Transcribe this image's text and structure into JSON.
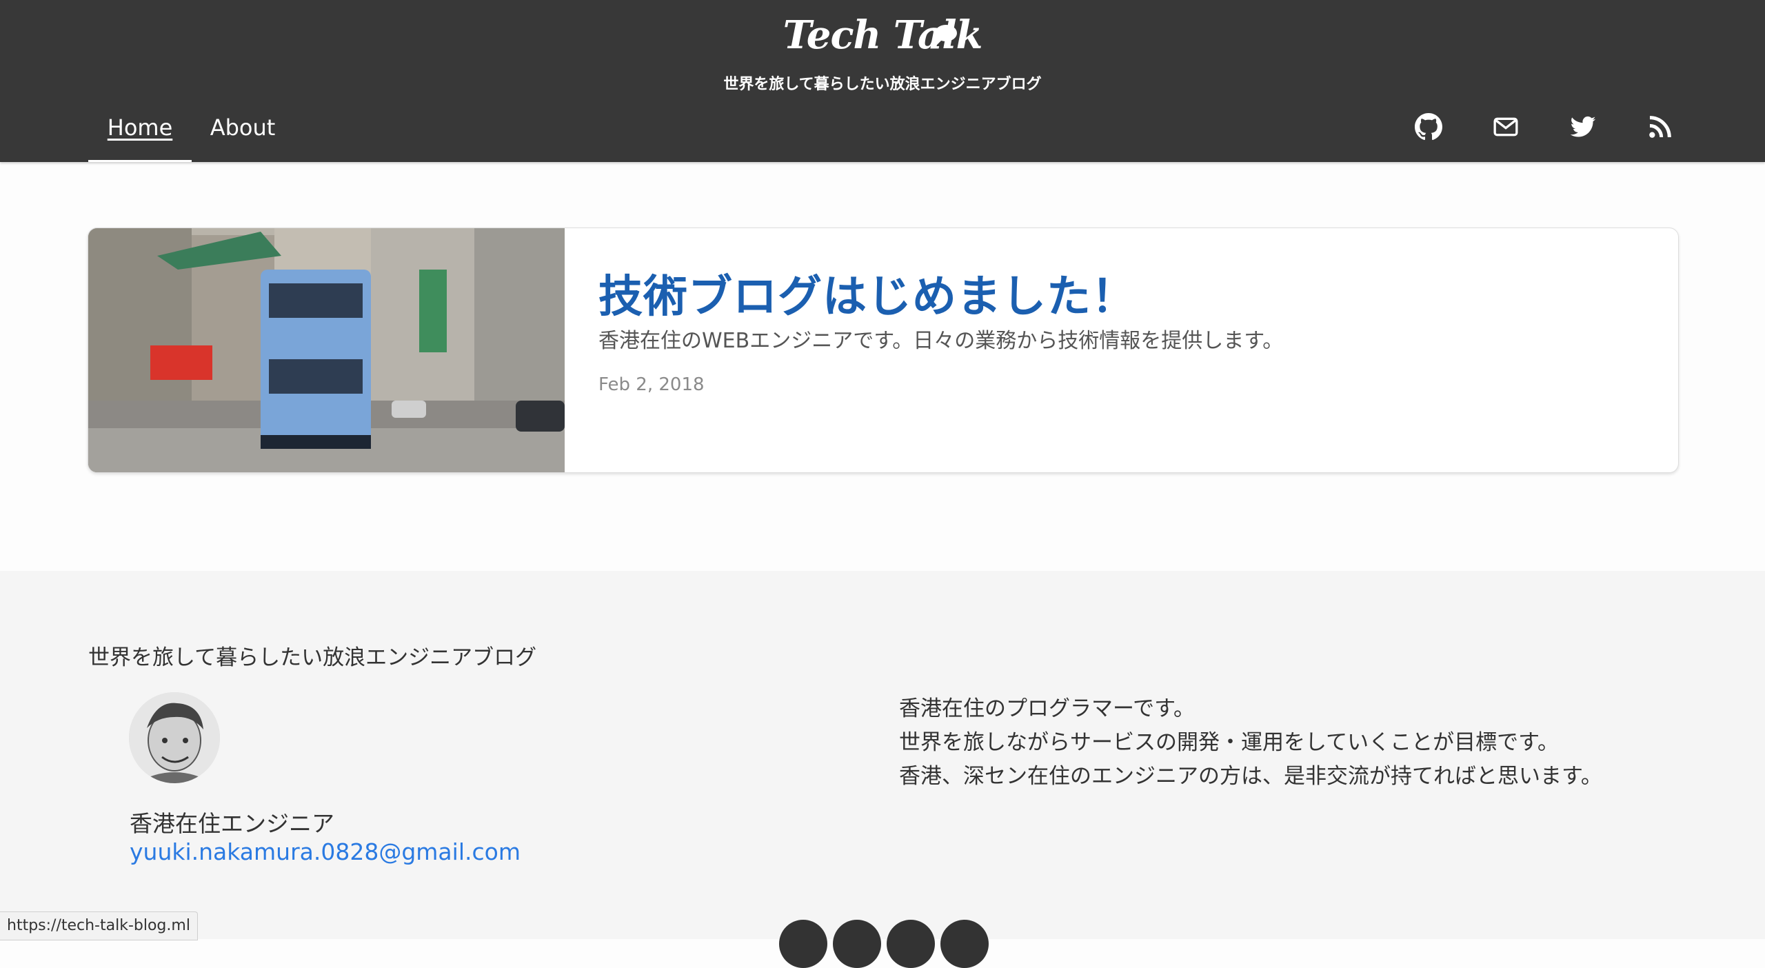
{
  "header": {
    "logo_text": "Tech Talk",
    "tagline": "世界を旅して暮らしたい放浪エンジニアブログ",
    "nav": [
      {
        "label": "Home",
        "active": true
      },
      {
        "label": "About",
        "active": false
      }
    ],
    "social_icons": [
      "github-icon",
      "mail-icon",
      "twitter-icon",
      "rss-icon"
    ]
  },
  "post": {
    "title": "技術ブログはじめました！",
    "excerpt": "香港在住のWEBエンジニアです。日々の業務から技術情報を提供します。",
    "date": "Feb 2, 2018"
  },
  "footer": {
    "title": "世界を旅して暮らしたい放浪エンジニアブログ",
    "author": "香港在住エンジニア",
    "email": "yuuki.nakamura.0828@gmail.com",
    "bio": [
      "香港在住のプログラマーです。",
      "世界を旅しながらサービスの開発・運用をしていくことが目標です。",
      "香港、深セン在住のエンジニアの方は、是非交流が持てればと思います。"
    ]
  },
  "status_bar": {
    "url": "https://tech-talk-blog.ml"
  },
  "colors": {
    "header_bg": "#383838",
    "title_link": "#1b5fb0",
    "email_link": "#2a7ae2",
    "footer_bg": "#f5f5f5"
  }
}
